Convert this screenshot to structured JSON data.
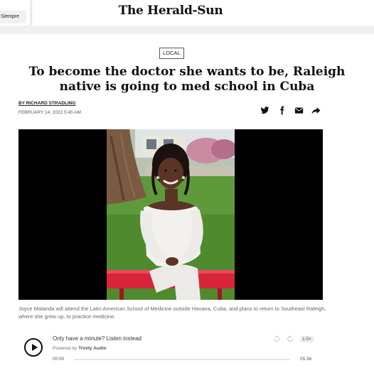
{
  "header": {
    "masthead": "The Herald-Sun",
    "popup_button": "Siempre"
  },
  "article": {
    "section_tag": "LOCAL",
    "headline": "To become the doctor she wants to be, Raleigh native is going to med school in Cuba",
    "byline": "BY RICHARD STRADLING",
    "dateline": "FEBRUARY 14, 2022 5:45 AM",
    "share_icons": [
      "twitter-icon",
      "facebook-icon",
      "email-icon",
      "share-icon"
    ],
    "caption": "Joyce Malanda will attend the Latin American School of Medicine outside Havana, Cuba, and plans to return to Southeast Raleigh, where she grew up, to practice medicine."
  },
  "audio": {
    "title": "Only have a minute? Listen instead",
    "powered_prefix": "Powered by",
    "powered_brand": "Trinity Audio",
    "speed": "1.0×",
    "time_current": "00:00",
    "time_total": "05:36",
    "progress": 0
  },
  "colors": {
    "text": "#111111",
    "bench_red": "#d8253a",
    "grass_green": "#5f9a3a"
  }
}
